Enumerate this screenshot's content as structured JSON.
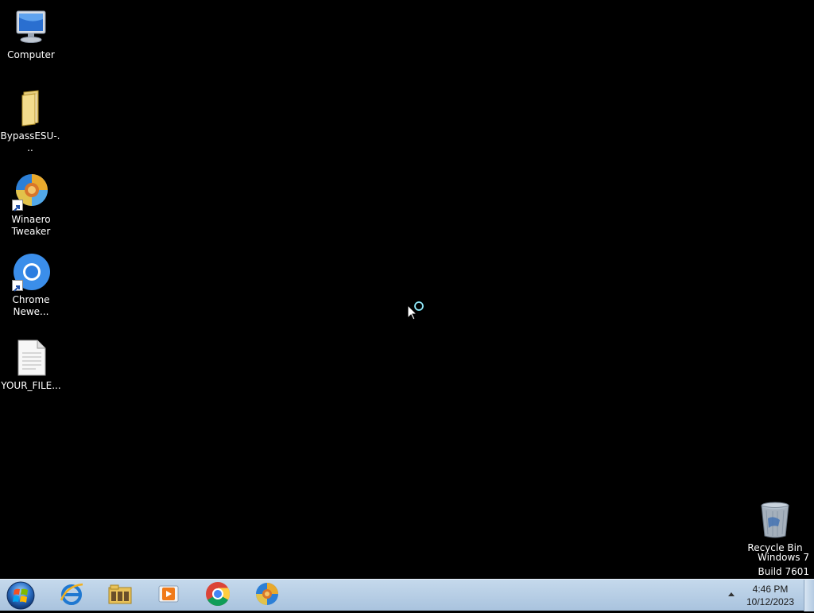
{
  "desktop": {
    "icons": [
      {
        "label": "Computer",
        "icon": "computer-icon"
      },
      {
        "label": "BypassESU-...",
        "icon": "folder-icon"
      },
      {
        "label": "Winaero Tweaker",
        "icon": "winaero-tweaker-icon"
      },
      {
        "label": "Chrome Newe...",
        "icon": "chrome-icon"
      },
      {
        "label": "YOUR_FILE...",
        "icon": "text-file-icon"
      }
    ],
    "recycle_bin": {
      "label": "Recycle Bin",
      "icon": "recycle-bin-icon"
    },
    "watermark": {
      "line1": "Windows 7",
      "line2": "Build 7601"
    }
  },
  "taskbar": {
    "start": {
      "icon": "windows-start-orb-icon"
    },
    "pinned": [
      {
        "icon": "internet-explorer-icon"
      },
      {
        "icon": "windows-explorer-icon"
      },
      {
        "icon": "media-player-icon"
      },
      {
        "icon": "chrome-icon"
      },
      {
        "icon": "winaero-tweaker-icon"
      }
    ],
    "tray": {
      "time": "4:46 PM",
      "date": "10/12/2023"
    }
  },
  "colors": {
    "desktop_background": "#000000",
    "taskbar": "#b7cde5"
  }
}
